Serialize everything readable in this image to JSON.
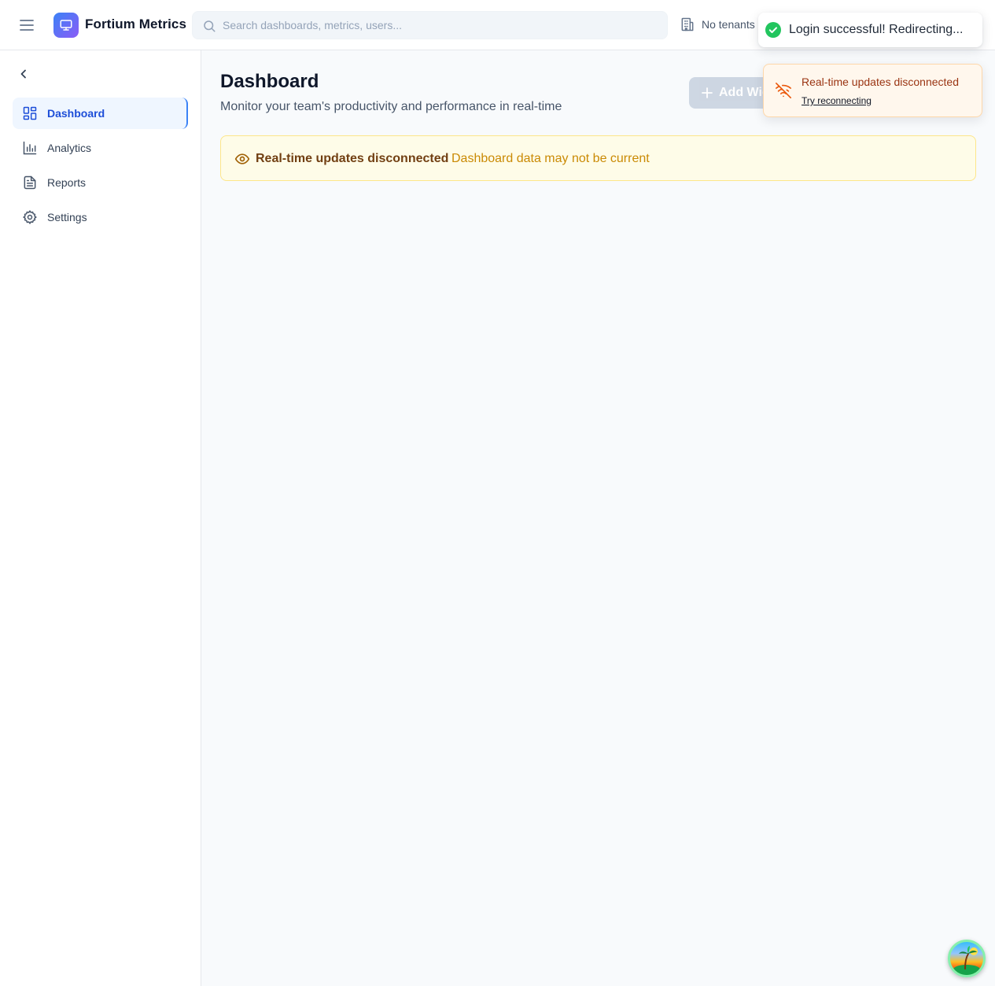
{
  "header": {
    "brand": "Fortium Metrics",
    "search_placeholder": "Search dashboards, metrics, users...",
    "tenant_label": "No tenants"
  },
  "sidebar": {
    "items": [
      {
        "label": "Dashboard",
        "icon": "dashboard-grid-icon",
        "active": true
      },
      {
        "label": "Analytics",
        "icon": "bar-chart-icon",
        "active": false
      },
      {
        "label": "Reports",
        "icon": "document-icon",
        "active": false
      },
      {
        "label": "Settings",
        "icon": "gear-icon",
        "active": false
      }
    ]
  },
  "main": {
    "title": "Dashboard",
    "subtitle": "Monitor your team's productivity and performance in real-time",
    "add_widget_label": "Add Widget"
  },
  "banner": {
    "title": "Real-time updates disconnected",
    "description": "Dashboard data may not be current"
  },
  "toasts": {
    "success": "Login successful! Redirecting...",
    "error_title": "Real-time updates disconnected",
    "error_action": "Try reconnecting"
  },
  "colors": {
    "accent": "#1d4ed8",
    "brand_gradient_start": "#3b82f6",
    "brand_gradient_end": "#8b5cf6",
    "warning_bg": "#fefce8",
    "warning_text": "#713f12",
    "error_bg": "#fff7ed",
    "success": "#22c55e"
  }
}
